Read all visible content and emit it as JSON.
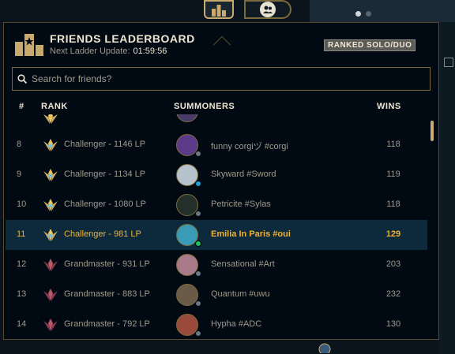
{
  "leaderboard": {
    "title": "FRIENDS LEADERBOARD",
    "update_label": "Next Ladder Update:",
    "update_timer": "01:59:56",
    "queue": "RANKED SOLO/DUO"
  },
  "search": {
    "placeholder": "Search for friends?"
  },
  "columns": {
    "num": "#",
    "rank": "RANK",
    "summoners": "SUMMONERS",
    "wins": "WINS"
  },
  "rows": [
    {
      "num": "8",
      "rank": "Challenger - 1146 LP",
      "summoner": "funny corgiヅ #corgi",
      "wins": "118",
      "tier": "challenger",
      "status": "#6b7680",
      "avatar": "#5b3a8a"
    },
    {
      "num": "9",
      "rank": "Challenger - 1134 LP",
      "summoner": "Skyward #Sword",
      "wins": "119",
      "tier": "challenger",
      "status": "#1aa2d6",
      "avatar": "#b6c2cc"
    },
    {
      "num": "10",
      "rank": "Challenger - 1080 LP",
      "summoner": "Petricite #Sylas",
      "wins": "118",
      "tier": "challenger",
      "status": "#6b7680",
      "avatar": "#23302a"
    },
    {
      "num": "11",
      "rank": "Challenger - 981 LP",
      "summoner": "Emilia In Paris #oui",
      "wins": "129",
      "tier": "challenger",
      "status": "#1fbf5a",
      "avatar": "#3a9bb6"
    },
    {
      "num": "12",
      "rank": "Grandmaster - 931 LP",
      "summoner": "Sensational #Art",
      "wins": "203",
      "tier": "grandmaster",
      "status": "#6b7680",
      "avatar": "#a87a8a"
    },
    {
      "num": "13",
      "rank": "Grandmaster - 883 LP",
      "summoner": "Quantum #uwu",
      "wins": "232",
      "tier": "grandmaster",
      "status": "#6b7680",
      "avatar": "#6a5a48"
    },
    {
      "num": "14",
      "rank": "Grandmaster - 792 LP",
      "summoner": "Hypha #ADC",
      "wins": "130",
      "tier": "grandmaster",
      "status": "#6b7680",
      "avatar": "#9a4a3a"
    }
  ]
}
